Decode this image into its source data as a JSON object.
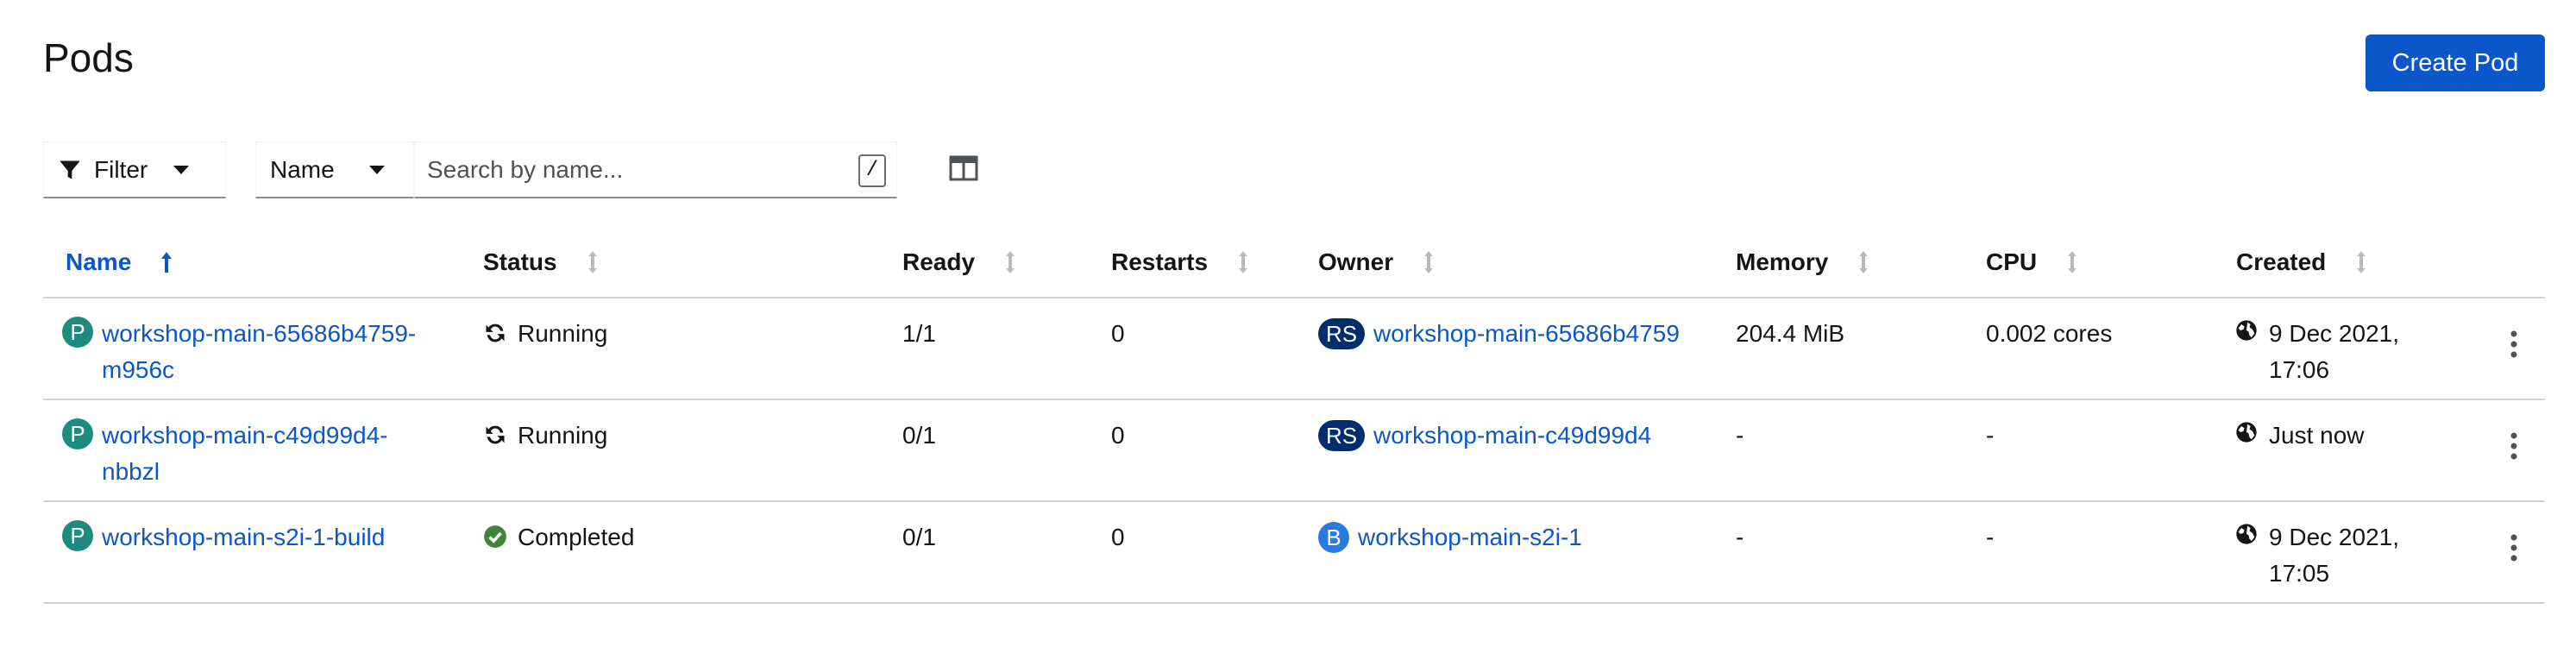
{
  "page": {
    "title": "Pods",
    "create_label": "Create Pod"
  },
  "toolbar": {
    "filter_label": "Filter",
    "name_select_label": "Name",
    "search_placeholder": "Search by name...",
    "search_shortcut": "/"
  },
  "table": {
    "columns": [
      "Name",
      "Status",
      "Ready",
      "Restarts",
      "Owner",
      "Memory",
      "CPU",
      "Created"
    ],
    "sorted_column": "Name",
    "rows": [
      {
        "badge": "P",
        "name_line1": "workshop-main-65686b4759-",
        "name_line2": "m956c",
        "status": "Running",
        "ready": "1/1",
        "restarts": "0",
        "owner_badge": "RS",
        "owner": "workshop-main-65686b4759",
        "memory": "204.4 MiB",
        "cpu": "0.002 cores",
        "created_line1": "9 Dec 2021,",
        "created_line2": "17:06"
      },
      {
        "badge": "P",
        "name_line1": "workshop-main-c49d99d4-",
        "name_line2": "nbbzl",
        "status": "Running",
        "ready": "0/1",
        "restarts": "0",
        "owner_badge": "RS",
        "owner": "workshop-main-c49d99d4",
        "memory": "-",
        "cpu": "-",
        "created_line1": "Just now",
        "created_line2": ""
      },
      {
        "badge": "P",
        "name_line1": "workshop-main-s2i-1-build",
        "name_line2": "",
        "status": "Completed",
        "ready": "0/1",
        "restarts": "0",
        "owner_badge": "B",
        "owner": "workshop-main-s2i-1",
        "memory": "-",
        "cpu": "-",
        "created_line1": "9 Dec 2021,",
        "created_line2": "17:05"
      }
    ]
  },
  "colors": {
    "link": "#0b57c9",
    "primary_button": "#0b57c9",
    "pod_badge": "#1e8b80",
    "rs_badge": "#002d6b",
    "build_badge": "#2b7ae2",
    "success": "#3e8635"
  },
  "icons": {
    "filter": "filter-icon",
    "columns": "manage-columns-icon",
    "running": "sync-icon",
    "completed": "check-circle-icon",
    "created": "globe-icon",
    "actions": "kebab-icon"
  }
}
